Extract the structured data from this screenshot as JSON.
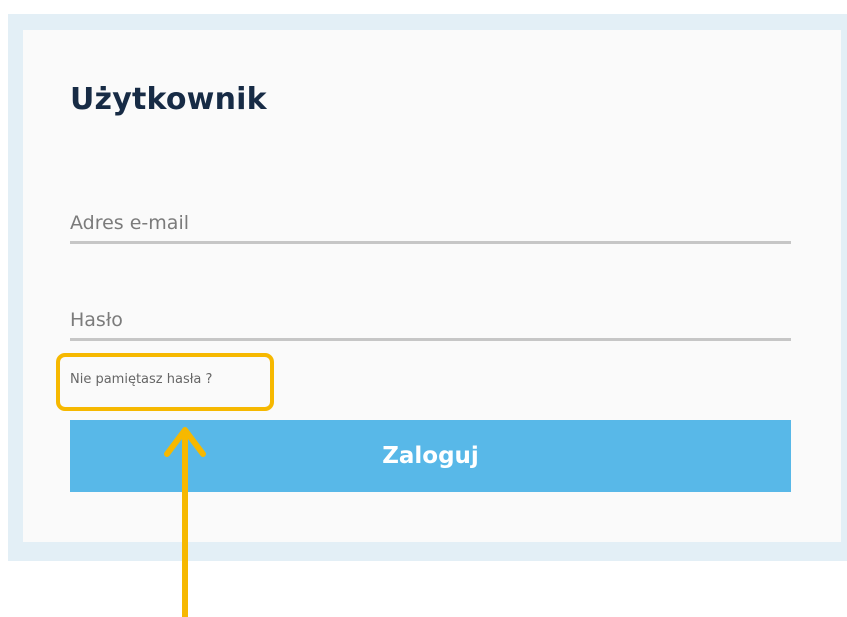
{
  "login": {
    "title": "Użytkownik",
    "email_placeholder": "Adres e-mail",
    "password_placeholder": "Hasło",
    "forgot_password_label": "Nie pamiętasz hasła ?",
    "submit_label": "Zaloguj"
  },
  "annotation": {
    "highlight_color": "#f6b800",
    "arrow_icon": "arrow-up-icon"
  },
  "colors": {
    "button": "#58b8e8",
    "title": "#172b45",
    "frame": "#e3eff6"
  }
}
